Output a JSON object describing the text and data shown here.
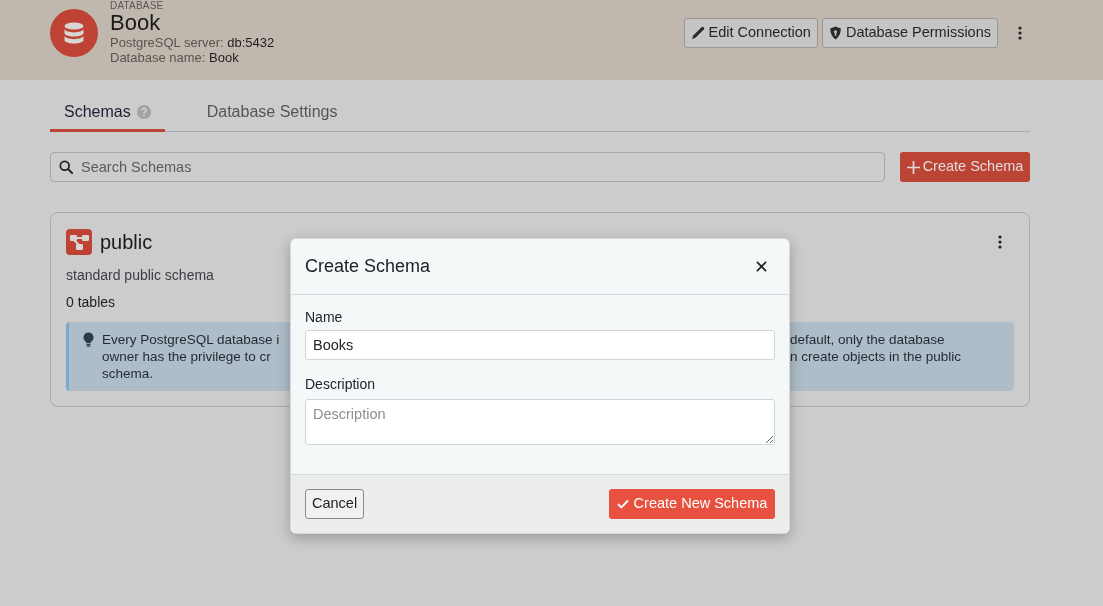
{
  "header": {
    "eyebrow": "DATABASE",
    "title": "Book",
    "details": [
      {
        "label": "PostgreSQL server:",
        "value": "db:5432"
      },
      {
        "label": "Database name:",
        "value": "Book"
      }
    ],
    "buttons": [
      {
        "kind": "edit",
        "label": "Edit Connection"
      },
      {
        "kind": "permissions",
        "label": "Database Permissions"
      }
    ]
  },
  "tabs": [
    {
      "label": "Schemas",
      "help": true,
      "selected": true
    },
    {
      "label": "Database Settings",
      "help": false,
      "selected": false
    }
  ],
  "search": {
    "placeholder": "Search Schemas"
  },
  "create_button": {
    "label": "Create Schema"
  },
  "schemas": [
    {
      "name": "public",
      "description": "standard public schema",
      "table_count": "0 tables",
      "note": {
        "visible_start": "Every PostgreSQL database i\nowner has the privilege to cr\nschema.",
        "visible_end": "default, only the database\nn create objects in the public"
      }
    }
  ],
  "dialog": {
    "title": "Create Schema",
    "fields": [
      {
        "kind": "input",
        "label": "Name",
        "value": "Books"
      },
      {
        "kind": "textarea",
        "label": "Description",
        "placeholder": "Description"
      }
    ],
    "buttons": [
      {
        "kind": "secondary",
        "label": "Cancel"
      },
      {
        "kind": "primary",
        "label": "Create New Schema"
      }
    ]
  }
}
